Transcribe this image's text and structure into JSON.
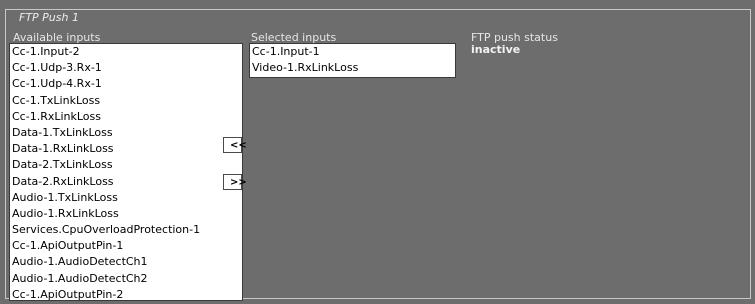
{
  "panel": {
    "legend": "FTP Push 1"
  },
  "available": {
    "label": "Available inputs",
    "items": [
      "Cc-1.Input-2",
      "Cc-1.Udp-3.Rx-1",
      "Cc-1.Udp-4.Rx-1",
      "Cc-1.TxLinkLoss",
      "Cc-1.RxLinkLoss",
      "Data-1.TxLinkLoss",
      "Data-1.RxLinkLoss",
      "Data-2.TxLinkLoss",
      "Data-2.RxLinkLoss",
      "Audio-1.TxLinkLoss",
      "Audio-1.RxLinkLoss",
      "Services.CpuOverloadProtection-1",
      "Cc-1.ApiOutputPin-1",
      "Audio-1.AudioDetectCh1",
      "Audio-1.AudioDetectCh2",
      "Cc-1.ApiOutputPin-2"
    ]
  },
  "buttons": {
    "remove_label": "<<",
    "add_label": ">>"
  },
  "selected": {
    "label": "Selected inputs",
    "items": [
      "Cc-1.Input-1",
      "Video-1.RxLinkLoss"
    ]
  },
  "status": {
    "label": "FTP push status",
    "value": "inactive"
  }
}
